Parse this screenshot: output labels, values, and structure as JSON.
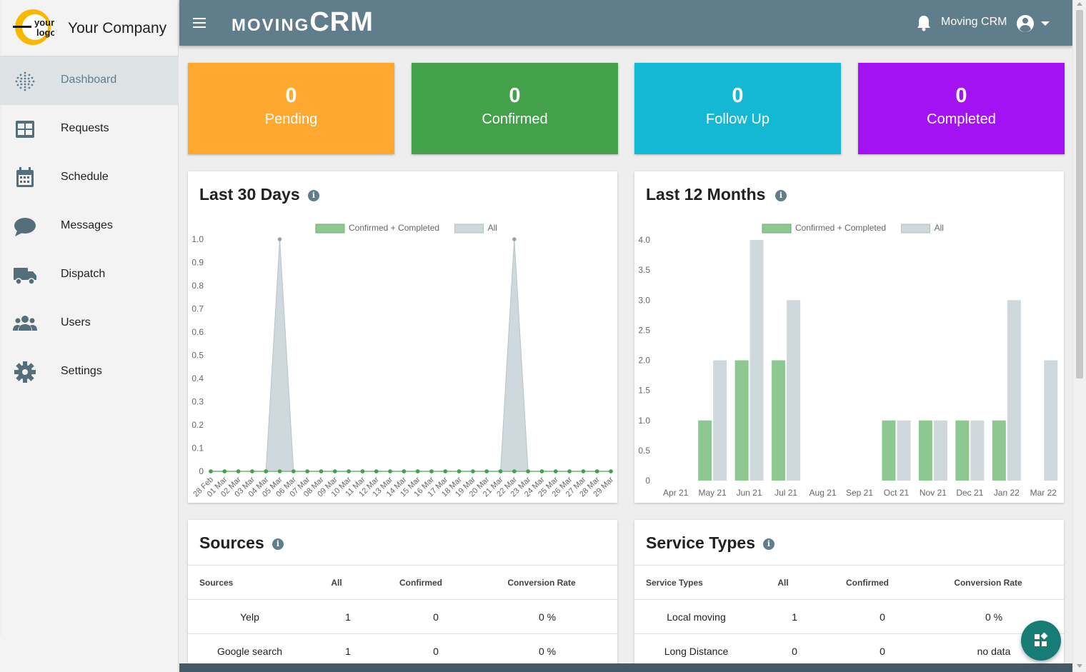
{
  "company": {
    "logo_text": "your logo",
    "name": "Your Company"
  },
  "sidebar": {
    "items": [
      {
        "label": "Dashboard",
        "icon": "dashboard-dots-icon"
      },
      {
        "label": "Requests",
        "icon": "table-icon"
      },
      {
        "label": "Schedule",
        "icon": "calendar-icon"
      },
      {
        "label": "Messages",
        "icon": "chat-bubble-icon"
      },
      {
        "label": "Dispatch",
        "icon": "truck-icon"
      },
      {
        "label": "Users",
        "icon": "users-icon"
      },
      {
        "label": "Settings",
        "icon": "gear-icon"
      }
    ]
  },
  "topbar": {
    "logo_part1": "MOVING",
    "logo_part2": "CRM",
    "user_name": "Moving CRM",
    "bg_color": "#607d8b"
  },
  "stats": [
    {
      "value": "0",
      "label": "Pending",
      "color": "#ffa930"
    },
    {
      "value": "0",
      "label": "Confirmed",
      "color": "#43a04b"
    },
    {
      "value": "0",
      "label": "Follow Up",
      "color": "#14b8d4"
    },
    {
      "value": "0",
      "label": "Completed",
      "color": "#a312f2"
    }
  ],
  "last30": {
    "title": "Last 30 Days",
    "legend": [
      "Confirmed + Completed",
      "All"
    ]
  },
  "last12": {
    "title": "Last 12 Months",
    "legend": [
      "Confirmed + Completed",
      "All"
    ]
  },
  "chart_data": [
    {
      "type": "area",
      "title": "Last 30 Days",
      "x": [
        "28 Feb",
        "01 Mar",
        "02 Mar",
        "03 Mar",
        "04 Mar",
        "05 Mar",
        "06 Mar",
        "07 Mar",
        "08 Mar",
        "09 Mar",
        "10 Mar",
        "11 Mar",
        "12 Mar",
        "13 Mar",
        "14 Mar",
        "15 Mar",
        "16 Mar",
        "17 Mar",
        "18 Mar",
        "19 Mar",
        "20 Mar",
        "21 Mar",
        "22 Mar",
        "23 Mar",
        "24 Mar",
        "25 Mar",
        "26 Mar",
        "27 Mar",
        "28 Mar",
        "29 Mar"
      ],
      "series": [
        {
          "name": "Confirmed + Completed",
          "color": "#8dc891",
          "values": [
            0,
            0,
            0,
            0,
            0,
            0,
            0,
            0,
            0,
            0,
            0,
            0,
            0,
            0,
            0,
            0,
            0,
            0,
            0,
            0,
            0,
            0,
            0,
            0,
            0,
            0,
            0,
            0,
            0,
            0
          ]
        },
        {
          "name": "All",
          "color": "#cfd8dc",
          "values": [
            0,
            0,
            0,
            0,
            0,
            1,
            0,
            0,
            0,
            0,
            0,
            0,
            0,
            0,
            0,
            0,
            0,
            0,
            0,
            0,
            0,
            0,
            1,
            0,
            0,
            0,
            0,
            0,
            0,
            0
          ]
        }
      ],
      "yticks": [
        "1.0",
        "0.9",
        "0.8",
        "0.7",
        "0.6",
        "0.5",
        "0.4",
        "0.3",
        "0.2",
        "0.1",
        "0"
      ],
      "ylim": [
        0,
        1
      ],
      "legend_position": "top"
    },
    {
      "type": "bar",
      "title": "Last 12 Months",
      "categories": [
        "Apr 21",
        "May 21",
        "Jun 21",
        "Jul 21",
        "Aug 21",
        "Sep 21",
        "Oct 21",
        "Nov 21",
        "Dec 21",
        "Jan 22",
        "Mar 22"
      ],
      "series": [
        {
          "name": "Confirmed + Completed",
          "color": "#8dc891",
          "values": [
            0,
            1,
            2,
            2,
            0,
            0,
            1,
            1,
            1,
            1,
            0
          ]
        },
        {
          "name": "All",
          "color": "#cfd8dc",
          "values": [
            0,
            2,
            4,
            3,
            0,
            0,
            1,
            1,
            1,
            3,
            2
          ]
        }
      ],
      "yticks": [
        "4.0",
        "3.5",
        "3.0",
        "2.5",
        "2.0",
        "1.5",
        "1.0",
        "0.5",
        "0"
      ],
      "ylim": [
        0,
        4
      ],
      "legend_position": "top"
    }
  ],
  "sources": {
    "title": "Sources",
    "columns": [
      "Sources",
      "All",
      "Confirmed",
      "Conversion Rate"
    ],
    "rows": [
      [
        "Yelp",
        "1",
        "0",
        "0 %"
      ],
      [
        "Google search",
        "1",
        "0",
        "0 %"
      ]
    ]
  },
  "service_types": {
    "title": "Service Types",
    "columns": [
      "Service Types",
      "All",
      "Confirmed",
      "Conversion Rate"
    ],
    "rows": [
      [
        "Local moving",
        "1",
        "0",
        "0 %"
      ],
      [
        "Long Distance",
        "0",
        "0",
        "no data"
      ]
    ]
  }
}
